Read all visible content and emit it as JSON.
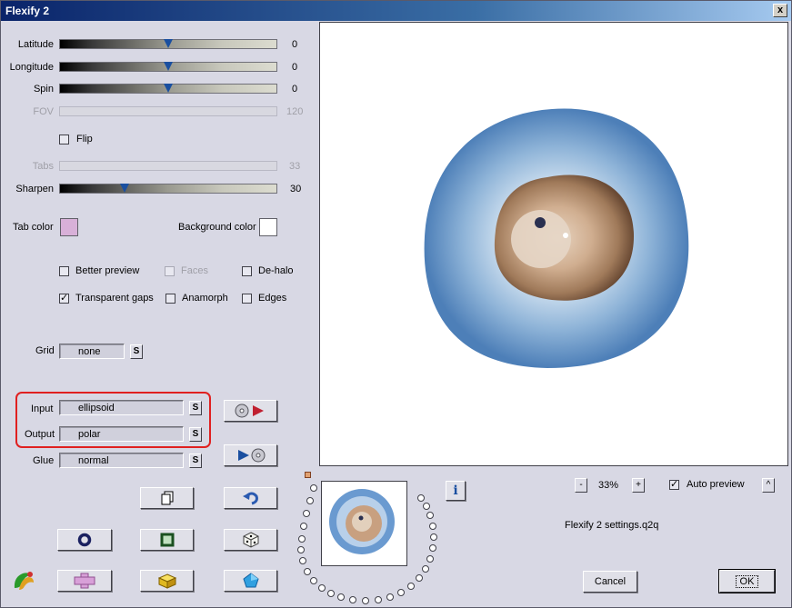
{
  "window": {
    "title": "Flexify 2",
    "close_glyph": "x"
  },
  "sliders": [
    {
      "label": "Latitude",
      "value": "0",
      "disabled": false,
      "position": 0.5
    },
    {
      "label": "Longitude",
      "value": "0",
      "disabled": false,
      "position": 0.5
    },
    {
      "label": "Spin",
      "value": "0",
      "disabled": false,
      "position": 0.5
    },
    {
      "label": "FOV",
      "value": "120",
      "disabled": true
    },
    {
      "label": "Tabs",
      "value": "33",
      "disabled": true
    },
    {
      "label": "Sharpen",
      "value": "30",
      "disabled": false,
      "position": 0.3
    }
  ],
  "flip": {
    "label": "Flip",
    "checked": false
  },
  "colors": {
    "tab_color_label": "Tab color",
    "tab_color": "#d8b0d8",
    "background_color_label": "Background color",
    "background_color": "#ffffff",
    "highlight": "#e02020",
    "thumb": "#1a4fa0"
  },
  "options": {
    "better_preview": {
      "label": "Better preview",
      "checked": false,
      "disabled": false
    },
    "faces": {
      "label": "Faces",
      "checked": false,
      "disabled": true
    },
    "de_halo": {
      "label": "De-halo",
      "checked": false,
      "disabled": false
    },
    "transparent_gaps": {
      "label": "Transparent gaps",
      "checked": true,
      "disabled": false
    },
    "anamorph": {
      "label": "Anamorph",
      "checked": false,
      "disabled": false
    },
    "edges": {
      "label": "Edges",
      "checked": false,
      "disabled": false
    }
  },
  "grid": {
    "label": "Grid",
    "value": "none",
    "s_label": "S"
  },
  "input": {
    "label": "Input",
    "value": "ellipsoid",
    "s_label": "S"
  },
  "output": {
    "label": "Output",
    "value": "polar",
    "s_label": "S"
  },
  "glue": {
    "label": "Glue",
    "value": "normal",
    "s_label": "S"
  },
  "zoom": {
    "minus": "-",
    "level": "33%",
    "plus": "+"
  },
  "auto_preview": {
    "label": "Auto preview",
    "checked": true,
    "up_glyph": "^"
  },
  "settings_file": "Flexify 2 settings.q2q",
  "info_glyph": "i",
  "buttons": {
    "cancel": "Cancel",
    "ok": "OK"
  },
  "icons": [
    "input-to-output-icon",
    "output-to-input-icon",
    "copy-icon",
    "undo-icon",
    "ring-icon",
    "square-icon",
    "dice-icon",
    "plus-shape-icon",
    "cube-icon",
    "pentagon-icon",
    "app-logo-icon",
    "info-icon"
  ]
}
